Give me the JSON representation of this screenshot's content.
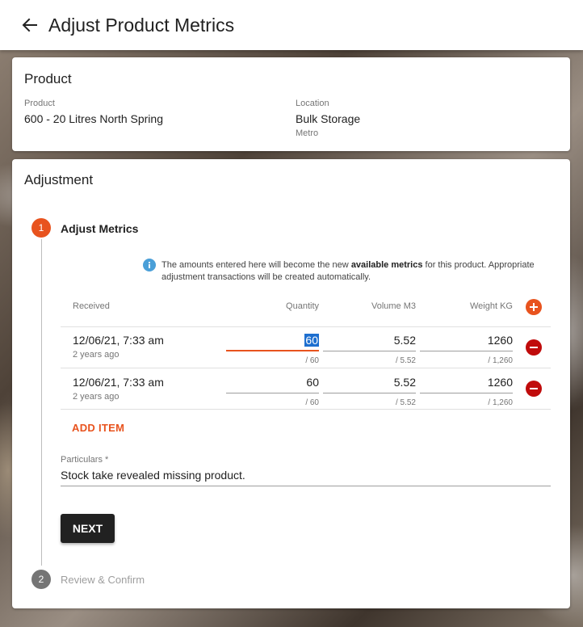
{
  "appbar": {
    "title": "Adjust Product Metrics"
  },
  "product_card": {
    "title": "Product",
    "product_label": "Product",
    "product_value": "600 - 20 Litres North Spring",
    "location_label": "Location",
    "location_value": "Bulk Storage",
    "location_sub": "Metro"
  },
  "adjustment_card": {
    "title": "Adjustment",
    "step1": {
      "number": "1",
      "label": "Adjust Metrics"
    },
    "step2": {
      "number": "2",
      "label": "Review & Confirm"
    },
    "info": {
      "prefix": "The amounts entered here will become the new ",
      "bold": "available metrics",
      "suffix": " for this product. Appropriate adjustment transactions will be created automatically."
    },
    "table": {
      "headers": {
        "received": "Received",
        "quantity": "Quantity",
        "volume": "Volume M3",
        "weight": "Weight KG"
      },
      "rows": [
        {
          "date": "12/06/21, 7:33 am",
          "ago": "2 years ago",
          "quantity": "60",
          "quantity_hint": "/ 60",
          "volume": "5.52",
          "volume_hint": "/ 5.52",
          "weight": "1260",
          "weight_hint": "/ 1,260"
        },
        {
          "date": "12/06/21, 7:33 am",
          "ago": "2 years ago",
          "quantity": "60",
          "quantity_hint": "/ 60",
          "volume": "5.52",
          "volume_hint": "/ 5.52",
          "weight": "1260",
          "weight_hint": "/ 1,260"
        }
      ]
    },
    "add_item_label": "ADD ITEM",
    "particulars_label": "Particulars *",
    "particulars_value": "Stock take revealed missing product.",
    "next_label": "NEXT"
  },
  "colors": {
    "accent": "#e8531e",
    "remove": "#c00b0b",
    "info": "#4a9fd8",
    "selection": "#1e6fcf"
  }
}
